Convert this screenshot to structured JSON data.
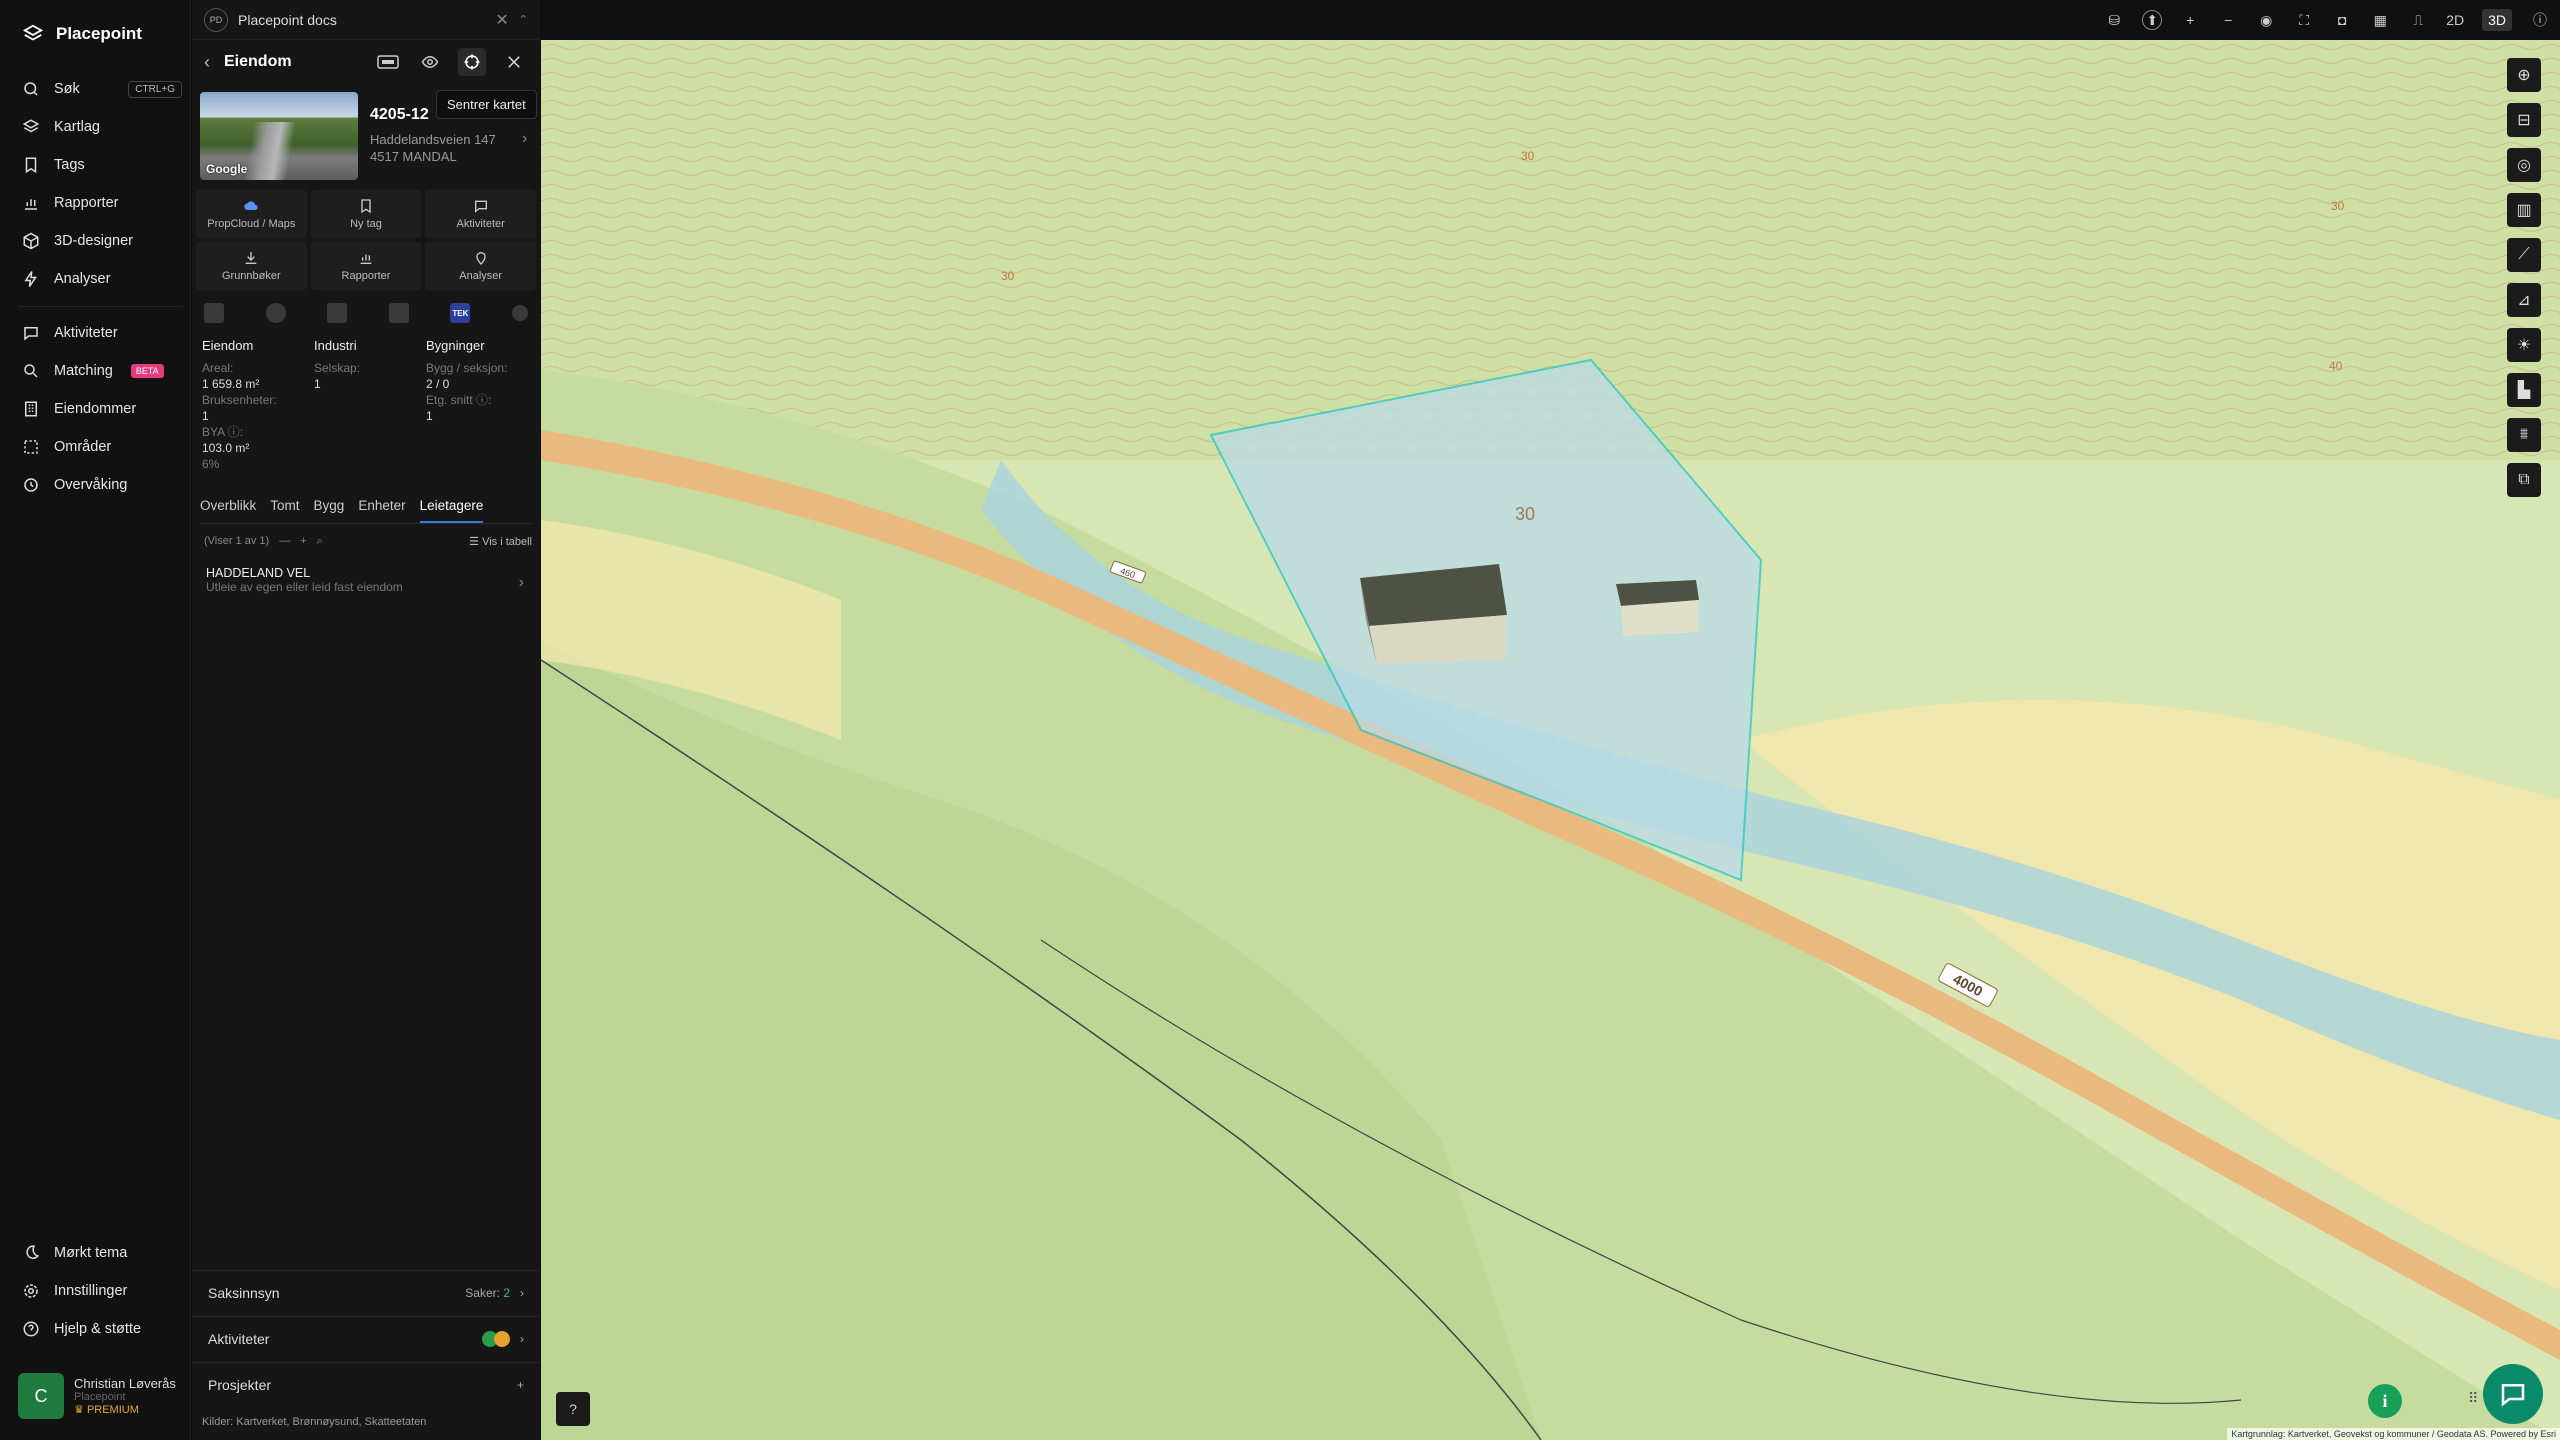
{
  "nav": {
    "brand": "Placepoint",
    "search_label": "Søk",
    "search_kbd": "CTRL+G",
    "items": [
      "Kartlag",
      "Tags",
      "Rapporter",
      "3D-designer",
      "Analyser"
    ],
    "items2": [
      "Aktiviteter",
      "Matching",
      "Eiendommer",
      "Områder",
      "Overvåking"
    ],
    "beta": "BETA",
    "bottom": [
      "Mørkt tema",
      "Innstillinger",
      "Hjelp & støtte"
    ],
    "user": {
      "initial": "C",
      "name": "Christian Løverås",
      "org": "Placepoint",
      "plan": "PREMIUM"
    }
  },
  "panel": {
    "workspace": "Placepoint docs",
    "workspace_abbr": "PD",
    "title": "Eiendom",
    "tooltip": "Sentrer kartet",
    "prop_id": "4205-12",
    "addr1": "Haddelandsveien 147",
    "addr2": "4517 MANDAL",
    "thumb_label": "Google",
    "buttons": [
      "PropCloud / Maps",
      "Ny tag",
      "Aktiviteter",
      "Grunnbøker",
      "Rapporter",
      "Analyser"
    ],
    "tek": "TEK",
    "facts": {
      "c1_head": "Eiendom",
      "c1_l1": "Areal:",
      "c1_v1": "1 659.8 m²",
      "c1_l2": "Bruksenheter:",
      "c1_v2": "1",
      "c1_l3": "BYA ⓘ:",
      "c1_v3": "103.0 m²",
      "c1_v4": "6%",
      "c2_head": "Industri",
      "c2_l1": "Selskap:",
      "c2_v1": "1",
      "c3_head": "Bygninger",
      "c3_l1": "Bygg / seksjon:",
      "c3_v1": "2 / 0",
      "c3_l2": "Etg. snitt ⓘ:",
      "c3_v2": "1"
    },
    "subtabs": [
      "Overblikk",
      "Tomt",
      "Bygg",
      "Enheter",
      "Leietagere"
    ],
    "toolbar": {
      "count": "(Viser 1 av 1)",
      "table": "Vis i tabell"
    },
    "list": [
      {
        "name": "HADDELAND VEL",
        "sub": "Utleie av egen eller leid fast eiendom"
      }
    ],
    "sections": {
      "saksinnsyn": "Saksinnsyn",
      "saker_label": "Saker:",
      "saker_count": "2",
      "aktiviteter": "Aktiviteter",
      "prosjekter": "Prosjekter"
    },
    "kilder": "Kilder:",
    "sources": [
      "Kartverket,",
      "Brønnøysund,",
      "Skatteetaten"
    ]
  },
  "map": {
    "view_2d": "2D",
    "view_3d": "3D",
    "road_label": "4000",
    "road_label2": "460",
    "contours": [
      "30",
      "30",
      "30",
      "40",
      "30"
    ],
    "credits": "Kartgrunnlag: Kartverket, Geovekst og kommuner / Geodata AS. Powered by Esri"
  },
  "colors": {
    "accent": "#2f7de1",
    "chat": "#0b8a6a",
    "info": "#18a058"
  }
}
